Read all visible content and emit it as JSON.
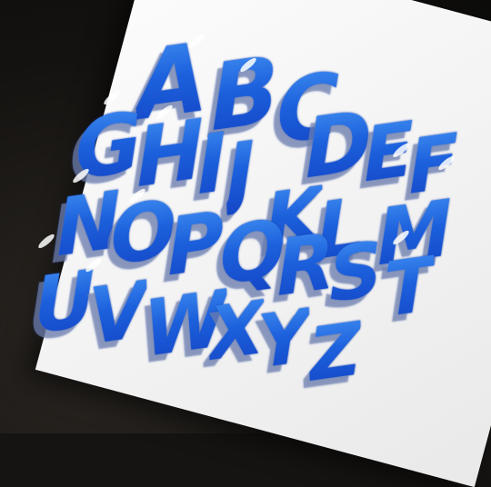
{
  "image": {
    "subject": "hand-lettered alphabet",
    "colors": {
      "letter_fill": "#1d5ed8",
      "letter_highlight": "#3d8bf0",
      "letter_shadow": "#8c96af",
      "paper": "#f4f4f4",
      "background": "#161412"
    },
    "rows": [
      [
        "A",
        "B",
        "C"
      ],
      [
        "G",
        "H",
        "I",
        "J",
        "D",
        "E",
        "F"
      ],
      [
        "N",
        "O",
        "P",
        "K",
        "L"
      ],
      [
        "Q",
        "R",
        "S",
        "M"
      ],
      [
        "U",
        "V",
        "W",
        "X",
        "Y",
        "T"
      ],
      [
        "Z"
      ]
    ]
  }
}
